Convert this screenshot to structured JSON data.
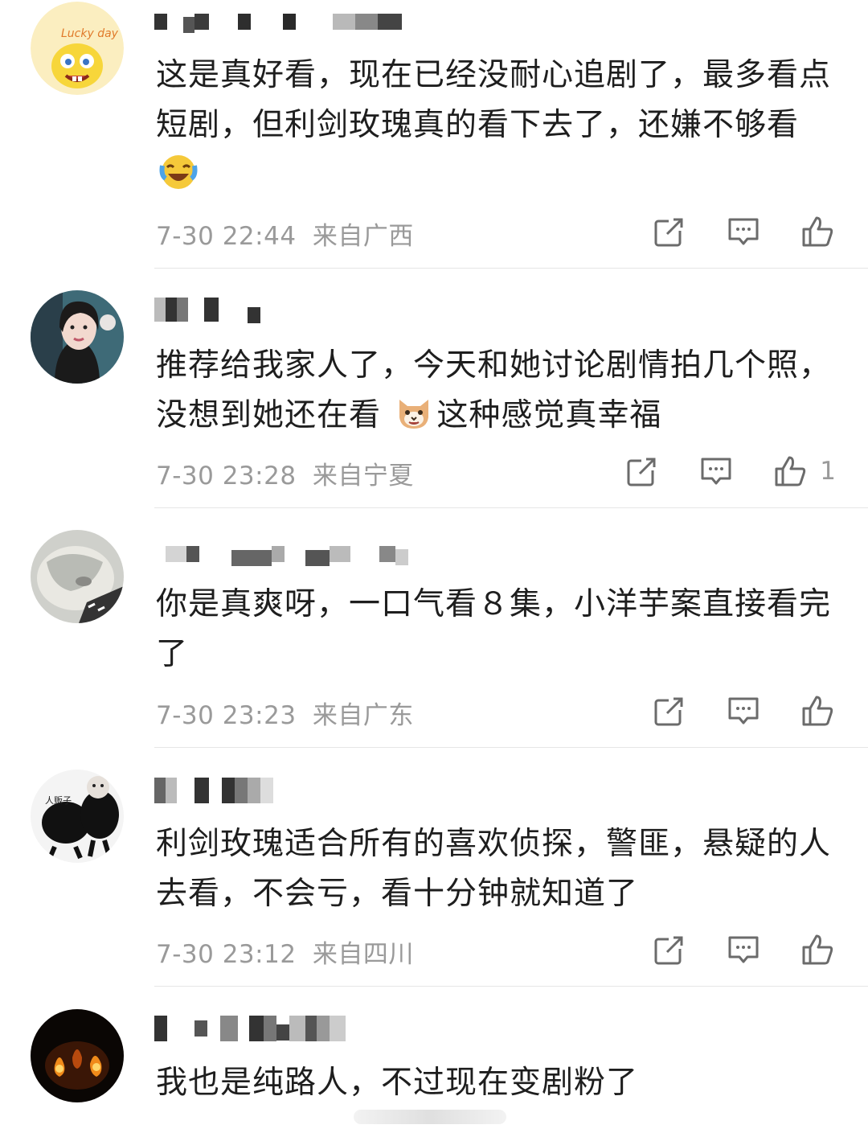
{
  "comments": [
    {
      "text_parts": [
        "这是真好看，现在已经没耐心追剧了，最多看点短剧，但利剑玫瑰真的看下去了，还嫌不够看",
        ""
      ],
      "emoji": "laughing-crying-emoji",
      "date": "7-30 22:44",
      "location": "来自广西",
      "likes": ""
    },
    {
      "text_parts": [
        "推荐给我家人了，今天和她讨论剧情拍几个照，没想到她还在看",
        "这种感觉真幸福"
      ],
      "emoji": "cat-face-emoji",
      "date": "7-30 23:28",
      "location": "来自宁夏",
      "likes": "1"
    },
    {
      "text_parts": [
        "你是真爽呀，一口气看８集，小洋芋案直接看完了",
        ""
      ],
      "emoji": "",
      "date": "7-30 23:23",
      "location": "来自广东",
      "likes": ""
    },
    {
      "text_parts": [
        "利剑玫瑰适合所有的喜欢侦探，警匪，悬疑的人去看，不会亏，看十分钟就知道了",
        ""
      ],
      "emoji": "",
      "date": "7-30 23:12",
      "location": "来自四川",
      "likes": ""
    },
    {
      "text_parts": [
        "我也是纯路人，不过现在变剧粉了",
        ""
      ],
      "emoji": "",
      "date": "",
      "location": "",
      "likes": ""
    }
  ],
  "avatar_texts": {
    "avatar1": "Lucky day",
    "avatar4": "人贩子"
  },
  "icons": {
    "repost": "repost-icon",
    "comment": "comment-icon",
    "like": "thumbs-up-icon"
  },
  "colors": {
    "meta_text": "#9a9a9a",
    "body_text": "#1e1e1e",
    "divider": "#e6e6e6",
    "icon": "#6b6b6b"
  }
}
